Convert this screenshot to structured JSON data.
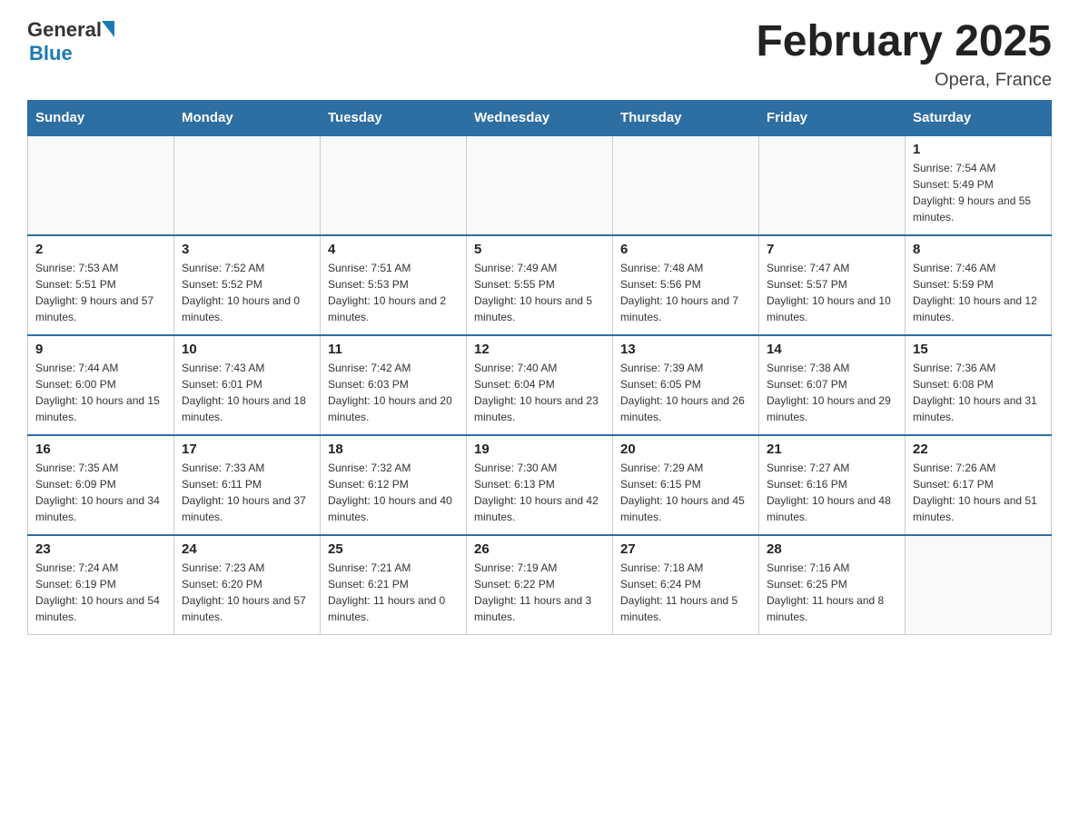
{
  "header": {
    "title": "February 2025",
    "location": "Opera, France",
    "logo_general": "General",
    "logo_blue": "Blue"
  },
  "weekdays": [
    "Sunday",
    "Monday",
    "Tuesday",
    "Wednesday",
    "Thursday",
    "Friday",
    "Saturday"
  ],
  "weeks": [
    [
      {
        "day": "",
        "info": ""
      },
      {
        "day": "",
        "info": ""
      },
      {
        "day": "",
        "info": ""
      },
      {
        "day": "",
        "info": ""
      },
      {
        "day": "",
        "info": ""
      },
      {
        "day": "",
        "info": ""
      },
      {
        "day": "1",
        "info": "Sunrise: 7:54 AM\nSunset: 5:49 PM\nDaylight: 9 hours and 55 minutes."
      }
    ],
    [
      {
        "day": "2",
        "info": "Sunrise: 7:53 AM\nSunset: 5:51 PM\nDaylight: 9 hours and 57 minutes."
      },
      {
        "day": "3",
        "info": "Sunrise: 7:52 AM\nSunset: 5:52 PM\nDaylight: 10 hours and 0 minutes."
      },
      {
        "day": "4",
        "info": "Sunrise: 7:51 AM\nSunset: 5:53 PM\nDaylight: 10 hours and 2 minutes."
      },
      {
        "day": "5",
        "info": "Sunrise: 7:49 AM\nSunset: 5:55 PM\nDaylight: 10 hours and 5 minutes."
      },
      {
        "day": "6",
        "info": "Sunrise: 7:48 AM\nSunset: 5:56 PM\nDaylight: 10 hours and 7 minutes."
      },
      {
        "day": "7",
        "info": "Sunrise: 7:47 AM\nSunset: 5:57 PM\nDaylight: 10 hours and 10 minutes."
      },
      {
        "day": "8",
        "info": "Sunrise: 7:46 AM\nSunset: 5:59 PM\nDaylight: 10 hours and 12 minutes."
      }
    ],
    [
      {
        "day": "9",
        "info": "Sunrise: 7:44 AM\nSunset: 6:00 PM\nDaylight: 10 hours and 15 minutes."
      },
      {
        "day": "10",
        "info": "Sunrise: 7:43 AM\nSunset: 6:01 PM\nDaylight: 10 hours and 18 minutes."
      },
      {
        "day": "11",
        "info": "Sunrise: 7:42 AM\nSunset: 6:03 PM\nDaylight: 10 hours and 20 minutes."
      },
      {
        "day": "12",
        "info": "Sunrise: 7:40 AM\nSunset: 6:04 PM\nDaylight: 10 hours and 23 minutes."
      },
      {
        "day": "13",
        "info": "Sunrise: 7:39 AM\nSunset: 6:05 PM\nDaylight: 10 hours and 26 minutes."
      },
      {
        "day": "14",
        "info": "Sunrise: 7:38 AM\nSunset: 6:07 PM\nDaylight: 10 hours and 29 minutes."
      },
      {
        "day": "15",
        "info": "Sunrise: 7:36 AM\nSunset: 6:08 PM\nDaylight: 10 hours and 31 minutes."
      }
    ],
    [
      {
        "day": "16",
        "info": "Sunrise: 7:35 AM\nSunset: 6:09 PM\nDaylight: 10 hours and 34 minutes."
      },
      {
        "day": "17",
        "info": "Sunrise: 7:33 AM\nSunset: 6:11 PM\nDaylight: 10 hours and 37 minutes."
      },
      {
        "day": "18",
        "info": "Sunrise: 7:32 AM\nSunset: 6:12 PM\nDaylight: 10 hours and 40 minutes."
      },
      {
        "day": "19",
        "info": "Sunrise: 7:30 AM\nSunset: 6:13 PM\nDaylight: 10 hours and 42 minutes."
      },
      {
        "day": "20",
        "info": "Sunrise: 7:29 AM\nSunset: 6:15 PM\nDaylight: 10 hours and 45 minutes."
      },
      {
        "day": "21",
        "info": "Sunrise: 7:27 AM\nSunset: 6:16 PM\nDaylight: 10 hours and 48 minutes."
      },
      {
        "day": "22",
        "info": "Sunrise: 7:26 AM\nSunset: 6:17 PM\nDaylight: 10 hours and 51 minutes."
      }
    ],
    [
      {
        "day": "23",
        "info": "Sunrise: 7:24 AM\nSunset: 6:19 PM\nDaylight: 10 hours and 54 minutes."
      },
      {
        "day": "24",
        "info": "Sunrise: 7:23 AM\nSunset: 6:20 PM\nDaylight: 10 hours and 57 minutes."
      },
      {
        "day": "25",
        "info": "Sunrise: 7:21 AM\nSunset: 6:21 PM\nDaylight: 11 hours and 0 minutes."
      },
      {
        "day": "26",
        "info": "Sunrise: 7:19 AM\nSunset: 6:22 PM\nDaylight: 11 hours and 3 minutes."
      },
      {
        "day": "27",
        "info": "Sunrise: 7:18 AM\nSunset: 6:24 PM\nDaylight: 11 hours and 5 minutes."
      },
      {
        "day": "28",
        "info": "Sunrise: 7:16 AM\nSunset: 6:25 PM\nDaylight: 11 hours and 8 minutes."
      },
      {
        "day": "",
        "info": ""
      }
    ]
  ]
}
